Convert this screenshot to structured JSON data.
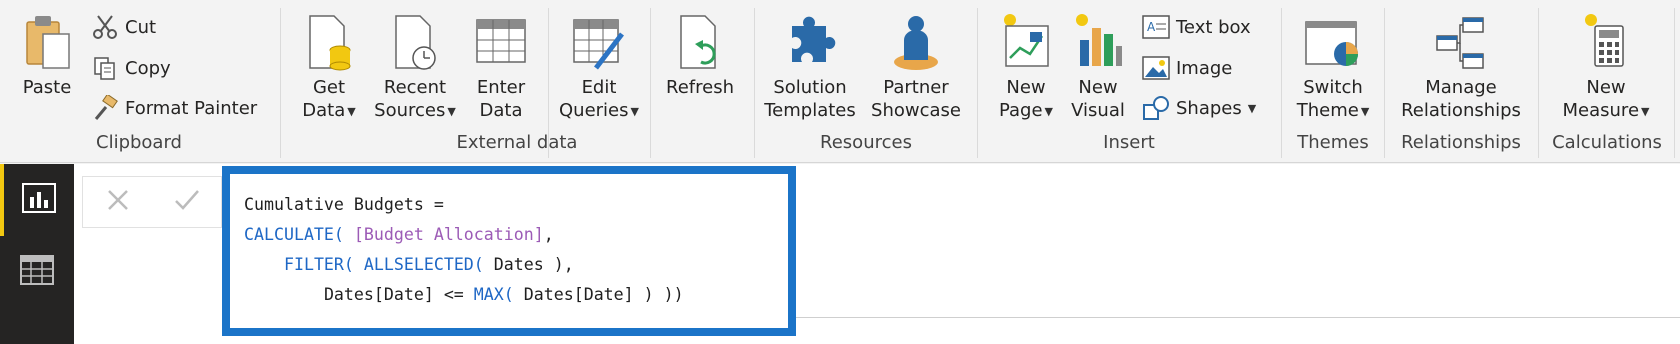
{
  "ribbon": {
    "clipboard": {
      "label": "Clipboard",
      "paste": "Paste",
      "cut": "Cut",
      "copy": "Copy",
      "format_painter": "Format Painter"
    },
    "external_data": {
      "label": "External data",
      "get_data": [
        "Get",
        "Data"
      ],
      "recent_sources": [
        "Recent",
        "Sources"
      ],
      "enter_data": [
        "Enter",
        "Data"
      ],
      "edit_queries": [
        "Edit",
        "Queries"
      ],
      "refresh": "Refresh"
    },
    "resources": {
      "label": "Resources",
      "solution_templates": [
        "Solution",
        "Templates"
      ],
      "partner_showcase": [
        "Partner",
        "Showcase"
      ]
    },
    "insert": {
      "label": "Insert",
      "new_page": [
        "New",
        "Page"
      ],
      "new_visual": [
        "New",
        "Visual"
      ],
      "text_box": "Text box",
      "image": "Image",
      "shapes": "Shapes"
    },
    "themes": {
      "label": "Themes",
      "switch_theme": [
        "Switch",
        "Theme"
      ]
    },
    "relationships": {
      "label": "Relationships",
      "manage_relationships": [
        "Manage",
        "Relationships"
      ]
    },
    "calculations": {
      "label": "Calculations",
      "new_measure": [
        "New",
        "Measure"
      ]
    }
  },
  "formula": {
    "line1": "Cumulative Budgets =",
    "line2_fn": "CALCULATE(",
    "line2_col": "[Budget Allocation]",
    "line2_end": ",",
    "line3_indent": "    ",
    "line3_fn1": "FILTER(",
    "line3_sp": " ",
    "line3_fn2": "ALLSELECTED(",
    "line3_rest": " Dates ),",
    "line4_indent": "        ",
    "line4_a": "Dates[Date] <= ",
    "line4_fn": "MAX(",
    "line4_b": " Dates[Date] ) ))"
  },
  "colors": {
    "highlight_border": "#1b74c8",
    "dax_function": "#1e67c5",
    "dax_measure": "#9c5bb6",
    "nav_bg": "#252423"
  }
}
